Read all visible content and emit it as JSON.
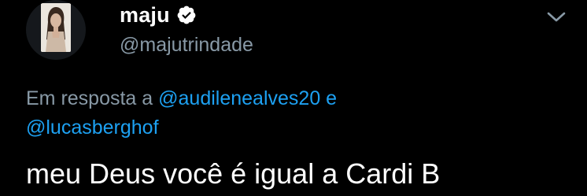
{
  "tweet": {
    "author": {
      "display_name": "maju",
      "handle": "@majutrindade",
      "verified": true,
      "avatar_icon": "profile-photo"
    },
    "reply_context": {
      "prefix": "Em resposta a ",
      "mention_1": "@audilenealves20",
      "conjunction": " e ",
      "mention_2": "@lucasberghof"
    },
    "text": "meu Deus você é igual a Cardi B",
    "menu_icon": "chevron-down-icon"
  },
  "colors": {
    "background": "#000000",
    "name": "#ffffff",
    "secondary": "#8899a6",
    "link": "#1da1f2",
    "verified_badge": "#ffffff"
  }
}
